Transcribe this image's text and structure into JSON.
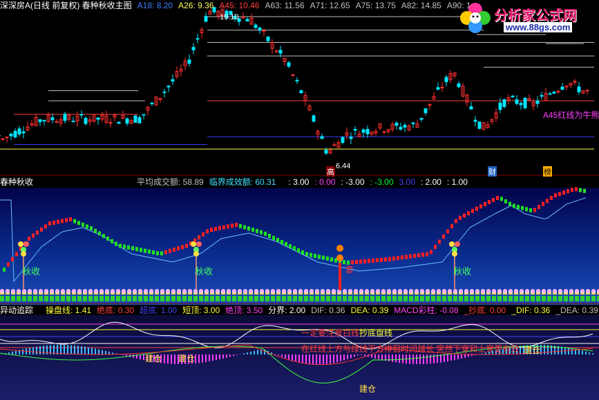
{
  "colors": {
    "up": "#ff3030",
    "down": "#00e5ff",
    "green": "#00ff40",
    "yellow": "#ffff00",
    "white": "#ffffff",
    "magenta": "#ff40ff",
    "blue": "#4040ff"
  },
  "panel1": {
    "title": "深深房A(日线 前复权) 春种秋收主图",
    "indicators": [
      {
        "label": "A18: 8.20",
        "color": "#4080ff"
      },
      {
        "label": "A26: 9.36",
        "color": "#ffff60"
      },
      {
        "label": "A45: 10.46",
        "color": "#ff4040"
      },
      {
        "label": "A63: 11.56",
        "color": "#c0c0c0"
      },
      {
        "label": "A71: 12.65",
        "color": "#c0c0c0"
      },
      {
        "label": "A75: 13.75",
        "color": "#c0c0c0"
      },
      {
        "label": "A82: 14.85",
        "color": "#c0c0c0"
      },
      {
        "label": "A90: 1",
        "color": "#c0c0c0"
      }
    ],
    "high_label": "19.10",
    "low_label": "6.44",
    "gao_label": "高",
    "cai_label": "财",
    "bang_label": "榜",
    "note": "A45红线为牛熊"
  },
  "panel2": {
    "title": "春种秋收",
    "avg_label": "平均成交额: 58.89",
    "crit_label": "临界成效额: 60.31",
    "v1": ": 3.00",
    "v2": ": 0.00",
    "v3": ": -3.00",
    "v4": ": -3.00",
    "v5": "3.00",
    "v6": ": 2.00",
    "v7": ": 1.00",
    "qiushou": "秋收",
    "tao_label": "套"
  },
  "panel3": {
    "title": "异动追踪",
    "items": [
      {
        "label": "操盘线: 1.41",
        "color": "#ffff40"
      },
      {
        "label": "绝底: 0.30",
        "color": "#ff4040"
      },
      {
        "label": "超底: 1.00",
        "color": "#4040ff"
      },
      {
        "label": "短顶: 3.00",
        "color": "#ffff40"
      },
      {
        "label": "绝顶: 3.50",
        "color": "#ff40ff"
      },
      {
        "label": "分界: 2.00",
        "color": "#ffffff"
      },
      {
        "label": "DIF: 0.36",
        "color": "#c0c0c0"
      },
      {
        "label": "DEA: 0.39",
        "color": "#ffff40"
      },
      {
        "label": "MACD彩柱: -0.08",
        "color": "#ff40ff"
      },
      {
        "label": "_抄底: 0.00",
        "color": "#ff4040"
      },
      {
        "label": "_DIF: 0.36",
        "color": "#ffff40"
      },
      {
        "label": "_DEA: 0.39",
        "color": "#c0c0c0"
      }
    ],
    "note1": "一定要注意白线",
    "note1b": "抄底盘线",
    "note2": "在红线上方与绿线下方徘徊时间越长  突然下穿和上穿更有效",
    "jian_cang": "建仓"
  },
  "logo": {
    "title": "分析家公式网",
    "url": "www.88gs.com"
  },
  "chart_data": [
    {
      "type": "candlestick",
      "title": "深深房A(日线 前复权) 春种秋收主图",
      "high": 19.1,
      "low": 6.44,
      "ma": {
        "A18": 8.2,
        "A26": 9.36,
        "A45": 10.46,
        "A63": 11.56,
        "A71": 12.65,
        "A75": 13.75,
        "A82": 14.85
      }
    },
    {
      "type": "bar",
      "title": "春种秋收",
      "avg": 58.89,
      "critical": 60.31
    },
    {
      "type": "line",
      "title": "异动追踪",
      "values": {
        "操盘线": 1.41,
        "绝底": 0.3,
        "超底": 1.0,
        "短顶": 3.0,
        "绝顶": 3.5,
        "分界": 2.0,
        "DIF": 0.36,
        "DEA": 0.39,
        "MACD彩柱": -0.08
      }
    }
  ]
}
